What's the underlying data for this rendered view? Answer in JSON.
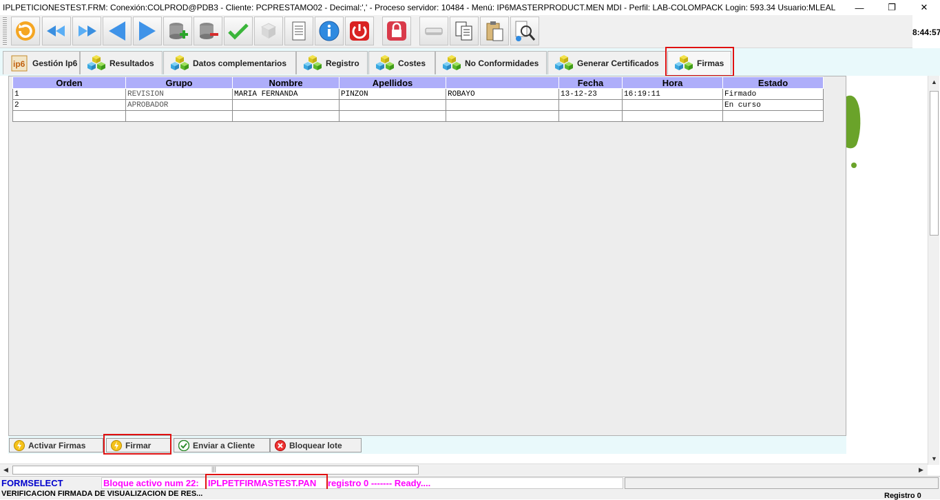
{
  "window": {
    "title": "IPLPETICIONESTEST.FRM:      Conexión:COLPROD@PDB3 - Cliente: PCPRESTAMO02 - Decimal:',' - Proceso servidor: 10484 - Menú: IP6MASTERPRODUCT.MEN MDI - Perfil: LAB-COLOMPACK Login: 593.34      Usuario:MLEAL",
    "minimize_glyph": "—",
    "restore_glyph": "❐",
    "close_glyph": "✕"
  },
  "toolbar": {
    "icons": [
      "refresh-icon",
      "first-record-icon",
      "last-record-icon",
      "previous-icon",
      "next-icon",
      "add-record-icon",
      "delete-record-icon",
      "confirm-icon",
      "cube-icon",
      "print-icon",
      "info-icon",
      "power-icon",
      "lock-icon",
      "eraser-icon",
      "copy-icon",
      "paste-icon",
      "search-icon"
    ],
    "clock": "8:44:57"
  },
  "tabs": [
    {
      "label": "Gestión Ip6",
      "icon": "ip6-logo-icon"
    },
    {
      "label": "Resultados",
      "icon": "cubes-icon"
    },
    {
      "label": "Datos complementarios",
      "icon": "cubes-icon"
    },
    {
      "label": "Registro",
      "icon": "cubes-icon"
    },
    {
      "label": "Costes",
      "icon": "cubes-icon"
    },
    {
      "label": "No Conformidades",
      "icon": "cubes-icon"
    },
    {
      "label": "Generar Certificados",
      "icon": "cubes-icon"
    },
    {
      "label": "Firmas",
      "icon": "cubes-icon",
      "active": true
    }
  ],
  "grid": {
    "columns": [
      "Orden",
      "Grupo",
      "Nombre",
      "Apellidos",
      "",
      "Fecha",
      "Hora",
      "Estado"
    ],
    "rows": [
      [
        "1",
        "REVISION",
        "MARIA FERNANDA",
        "PINZON",
        "ROBAYO",
        "13-12-23",
        "16:19:11",
        "Firmado"
      ],
      [
        "2",
        "APROBADOR",
        "",
        "",
        "",
        "",
        "",
        "En curso"
      ],
      [
        "",
        "",
        "",
        "",
        "",
        "",
        "",
        ""
      ]
    ]
  },
  "actions": {
    "activar": "Activar Firmas",
    "firmar": "Firmar",
    "enviar": "Enviar a Cliente",
    "bloquear": "Bloquear lote"
  },
  "status": {
    "form": "FORMSELECT",
    "bloque": "Bloque activo num 22:",
    "pan": "IPLPETFIRMASTEST.PAN",
    "registro_ready": "registro 0 ------- Ready....",
    "message": "VERIFICACION FIRMADA DE VISUALIZACION DE RES...",
    "registro": "Registro 0"
  },
  "scroll": {
    "left_arrow": "◀",
    "right_arrow": "▶",
    "up_arrow": "▲",
    "down_arrow": "▼",
    "grip": "|||"
  },
  "colors": {
    "header": "#aeaefa",
    "highlight": "#e01010",
    "status_magenta": "#ff00ff",
    "status_blue": "#0000cc"
  }
}
